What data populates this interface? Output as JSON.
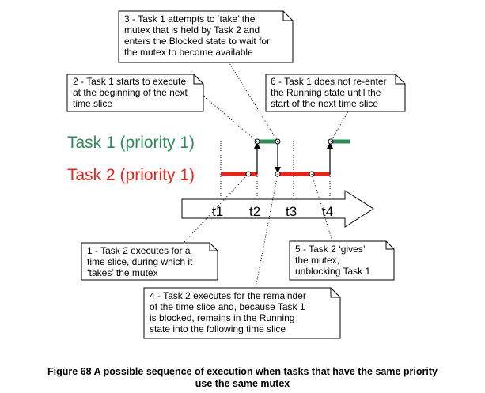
{
  "colors": {
    "task1": "#2e8b57",
    "task2": "#e8241c",
    "line": "#000000"
  },
  "tasks": {
    "task1_label": "Task 1 (priority 1)",
    "task2_label": "Task 2 (priority 1)"
  },
  "ticks": [
    "t1",
    "t2",
    "t3",
    "t4"
  ],
  "notes": {
    "n1": [
      "1 - Task 2 executes for a",
      "time slice, during which it",
      "‘takes’ the mutex"
    ],
    "n2": [
      "2 - Task 1 starts to execute",
      "at the beginning of the next",
      "time slice"
    ],
    "n3": [
      "3 - Task 1 attempts to ‘take’ the",
      "mutex that is held by Task 2 and",
      "enters the Blocked state to wait for",
      "the mutex to become available"
    ],
    "n4": [
      "4 - Task 2 executes for the remainder",
      "of the time slice and, because Task 1",
      "is blocked, remains in the Running",
      "state into the following time slice"
    ],
    "n5": [
      "5 - Task 2 ‘gives’",
      "the mutex,",
      "unblocking Task 1"
    ],
    "n6": [
      "6 - Task 1 does not re-enter",
      "the Running state until the",
      "start of the next time slice"
    ]
  },
  "caption": {
    "line1": "Figure 68 A possible sequence of execution when tasks that have the same priority",
    "line2": "use the same mutex"
  }
}
